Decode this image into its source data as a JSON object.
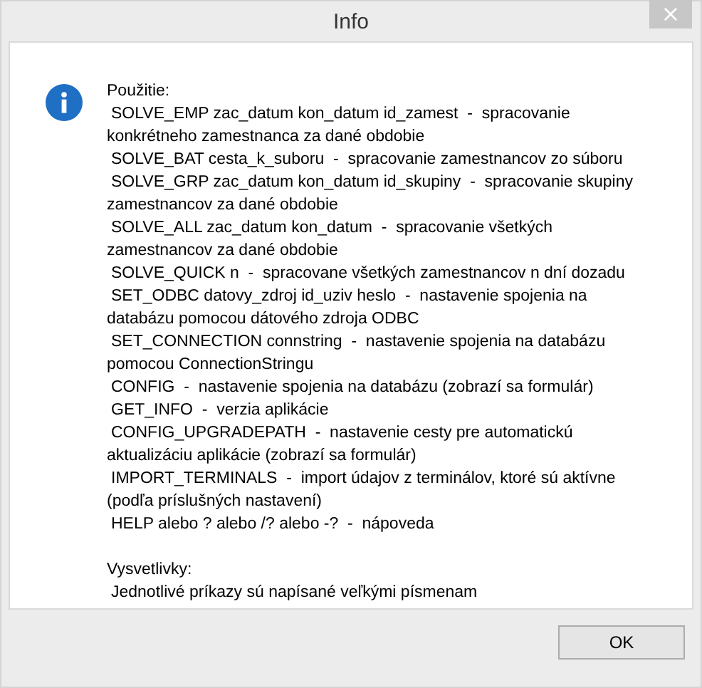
{
  "window": {
    "title": "Info",
    "close": "×"
  },
  "message": {
    "usage_title": "Použitie:",
    "commands": [
      "SOLVE_EMP zac_datum kon_datum id_zamest  -  spracovanie konkrétneho zamestnanca za dané obdobie",
      "SOLVE_BAT cesta_k_suboru  -  spracovanie zamestnancov zo súboru",
      "SOLVE_GRP zac_datum kon_datum id_skupiny  -  spracovanie skupiny zamestnancov za dané obdobie",
      "SOLVE_ALL zac_datum kon_datum  -  spracovanie všetkých zamestnancov za dané obdobie",
      "SOLVE_QUICK n  -  spracovane všetkých zamestnancov n dní dozadu",
      "SET_ODBC datovy_zdroj id_uziv heslo  -  nastavenie spojenia na databázu pomocou dátového zdroja ODBC",
      "SET_CONNECTION connstring  -  nastavenie spojenia na databázu pomocou ConnectionStringu",
      "CONFIG  -  nastavenie spojenia na databázu (zobrazí sa formulár)",
      "GET_INFO  -  verzia aplikácie",
      "CONFIG_UPGRADEPATH  -  nastavenie cesty pre automatickú aktualizáciu aplikácie (zobrazí sa formulár)",
      "IMPORT_TERMINALS  -  import údajov z terminálov, ktoré sú aktívne (podľa príslušných nastavení)",
      "HELP alebo ? alebo /? alebo -?  -  nápoveda"
    ],
    "notes_title": "Vysvetlivky:",
    "notes": [
      "Jednotlivé príkazy sú napísané veľkými písmenam"
    ]
  },
  "buttons": [
    "OK"
  ]
}
